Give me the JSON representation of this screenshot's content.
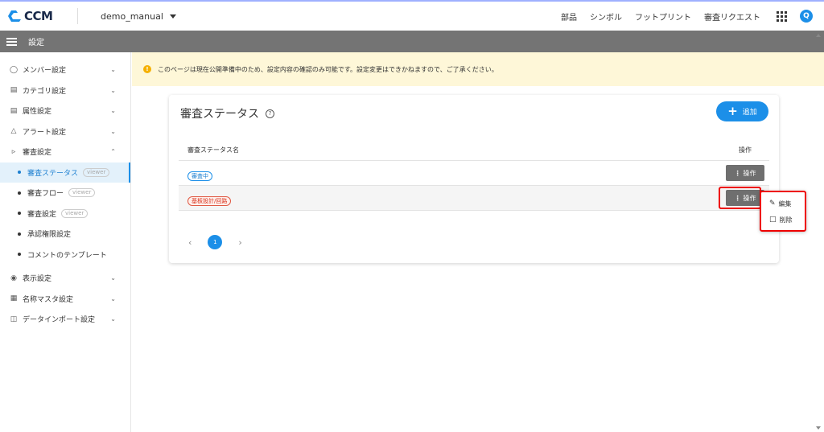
{
  "app": {
    "logo_text": "CCM",
    "project_name": "demo_manual"
  },
  "topnav": {
    "items": [
      "部品",
      "シンボル",
      "フットプリント",
      "審査リクエスト"
    ],
    "user_initial": "Q"
  },
  "header": {
    "title": "設定"
  },
  "sidebar": {
    "items": [
      {
        "label": "メンバー設定",
        "icon": "person-icon"
      },
      {
        "label": "カテゴリ設定",
        "icon": "category-icon"
      },
      {
        "label": "属性設定",
        "icon": "attribute-icon"
      },
      {
        "label": "アラート設定",
        "icon": "bell-icon"
      },
      {
        "label": "審査設定",
        "icon": "stamp-icon"
      }
    ],
    "sub_items": [
      {
        "label": "審査ステータス",
        "badge": "viewer"
      },
      {
        "label": "審査フロー",
        "badge": "viewer"
      },
      {
        "label": "審査設定",
        "badge": "viewer"
      },
      {
        "label": "承認権限設定"
      },
      {
        "label": "コメントのテンプレート"
      }
    ],
    "items_after": [
      {
        "label": "表示設定",
        "icon": "eye-icon"
      },
      {
        "label": "名称マスタ設定",
        "icon": "table-icon"
      },
      {
        "label": "データインポート設定",
        "icon": "database-icon"
      }
    ]
  },
  "notice": {
    "text": "このページは現在公開準備中のため、設定内容の確認のみ可能です。設定変更はできかねますので、ご了承ください。"
  },
  "card": {
    "title": "審査ステータス",
    "add_label": "追加",
    "columns": [
      "審査ステータス名",
      "操作"
    ],
    "rows": [
      {
        "status": "審査中",
        "color": "#1c8fe8",
        "action": "操作"
      },
      {
        "status": "基板設計/回路",
        "color": "#e05a45",
        "action": "操作"
      }
    ],
    "pagination": {
      "current": "1"
    }
  },
  "context_menu": {
    "items": [
      {
        "label": "編集",
        "icon": "pencil-icon"
      },
      {
        "label": "削除",
        "icon": "trash-icon"
      }
    ]
  },
  "colors": {
    "accent": "#1c8fe8",
    "header": "#747474",
    "highlight": "#e00000",
    "notice_bg": "#fef7d8"
  }
}
